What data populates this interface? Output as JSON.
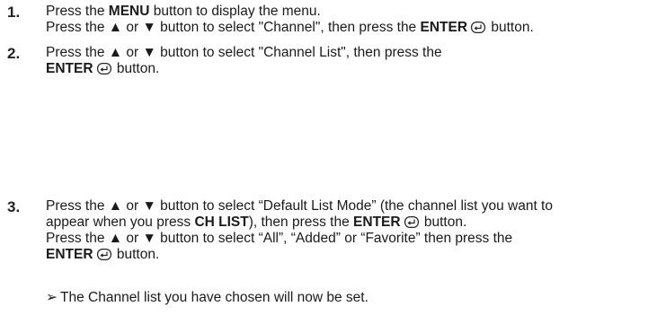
{
  "steps": [
    {
      "number": "1.",
      "lines": [
        {
          "pre": "Press the ",
          "bold": "MENU",
          "post": " button to display the menu."
        },
        {
          "pre": "Press the ▲ or ▼ button to select \"Channel\", then press the ",
          "bold": "ENTER",
          "icon": true,
          "post": " button."
        }
      ]
    },
    {
      "number": "2.",
      "lines": [
        {
          "pre": "Press the ▲ or ▼ button to select \"Channel List\", then press the",
          "bold": "",
          "post": ""
        },
        {
          "pre": "",
          "bold": "ENTER",
          "icon": true,
          "post": " button."
        }
      ]
    },
    {
      "number": "3.",
      "lines": [
        {
          "pre": "Press the ▲ or ▼ button to select “Default List Mode” (the channel list you want to",
          "bold": "",
          "post": ""
        },
        {
          "pre": "appear when you press ",
          "bold": "CH LIST",
          "post": "), then press the ",
          "bold2": "ENTER",
          "icon2": true,
          "post2": " button."
        },
        {
          "pre": "Press the ▲ or ▼ button to select “All”, “Added” or “Favorite” then press the",
          "bold": "",
          "post": ""
        },
        {
          "pre": "",
          "bold": "ENTER",
          "icon": true,
          "post": " button."
        }
      ]
    }
  ],
  "note": {
    "symbol": "➢",
    "text": "The Channel list you have chosen will now be set."
  }
}
